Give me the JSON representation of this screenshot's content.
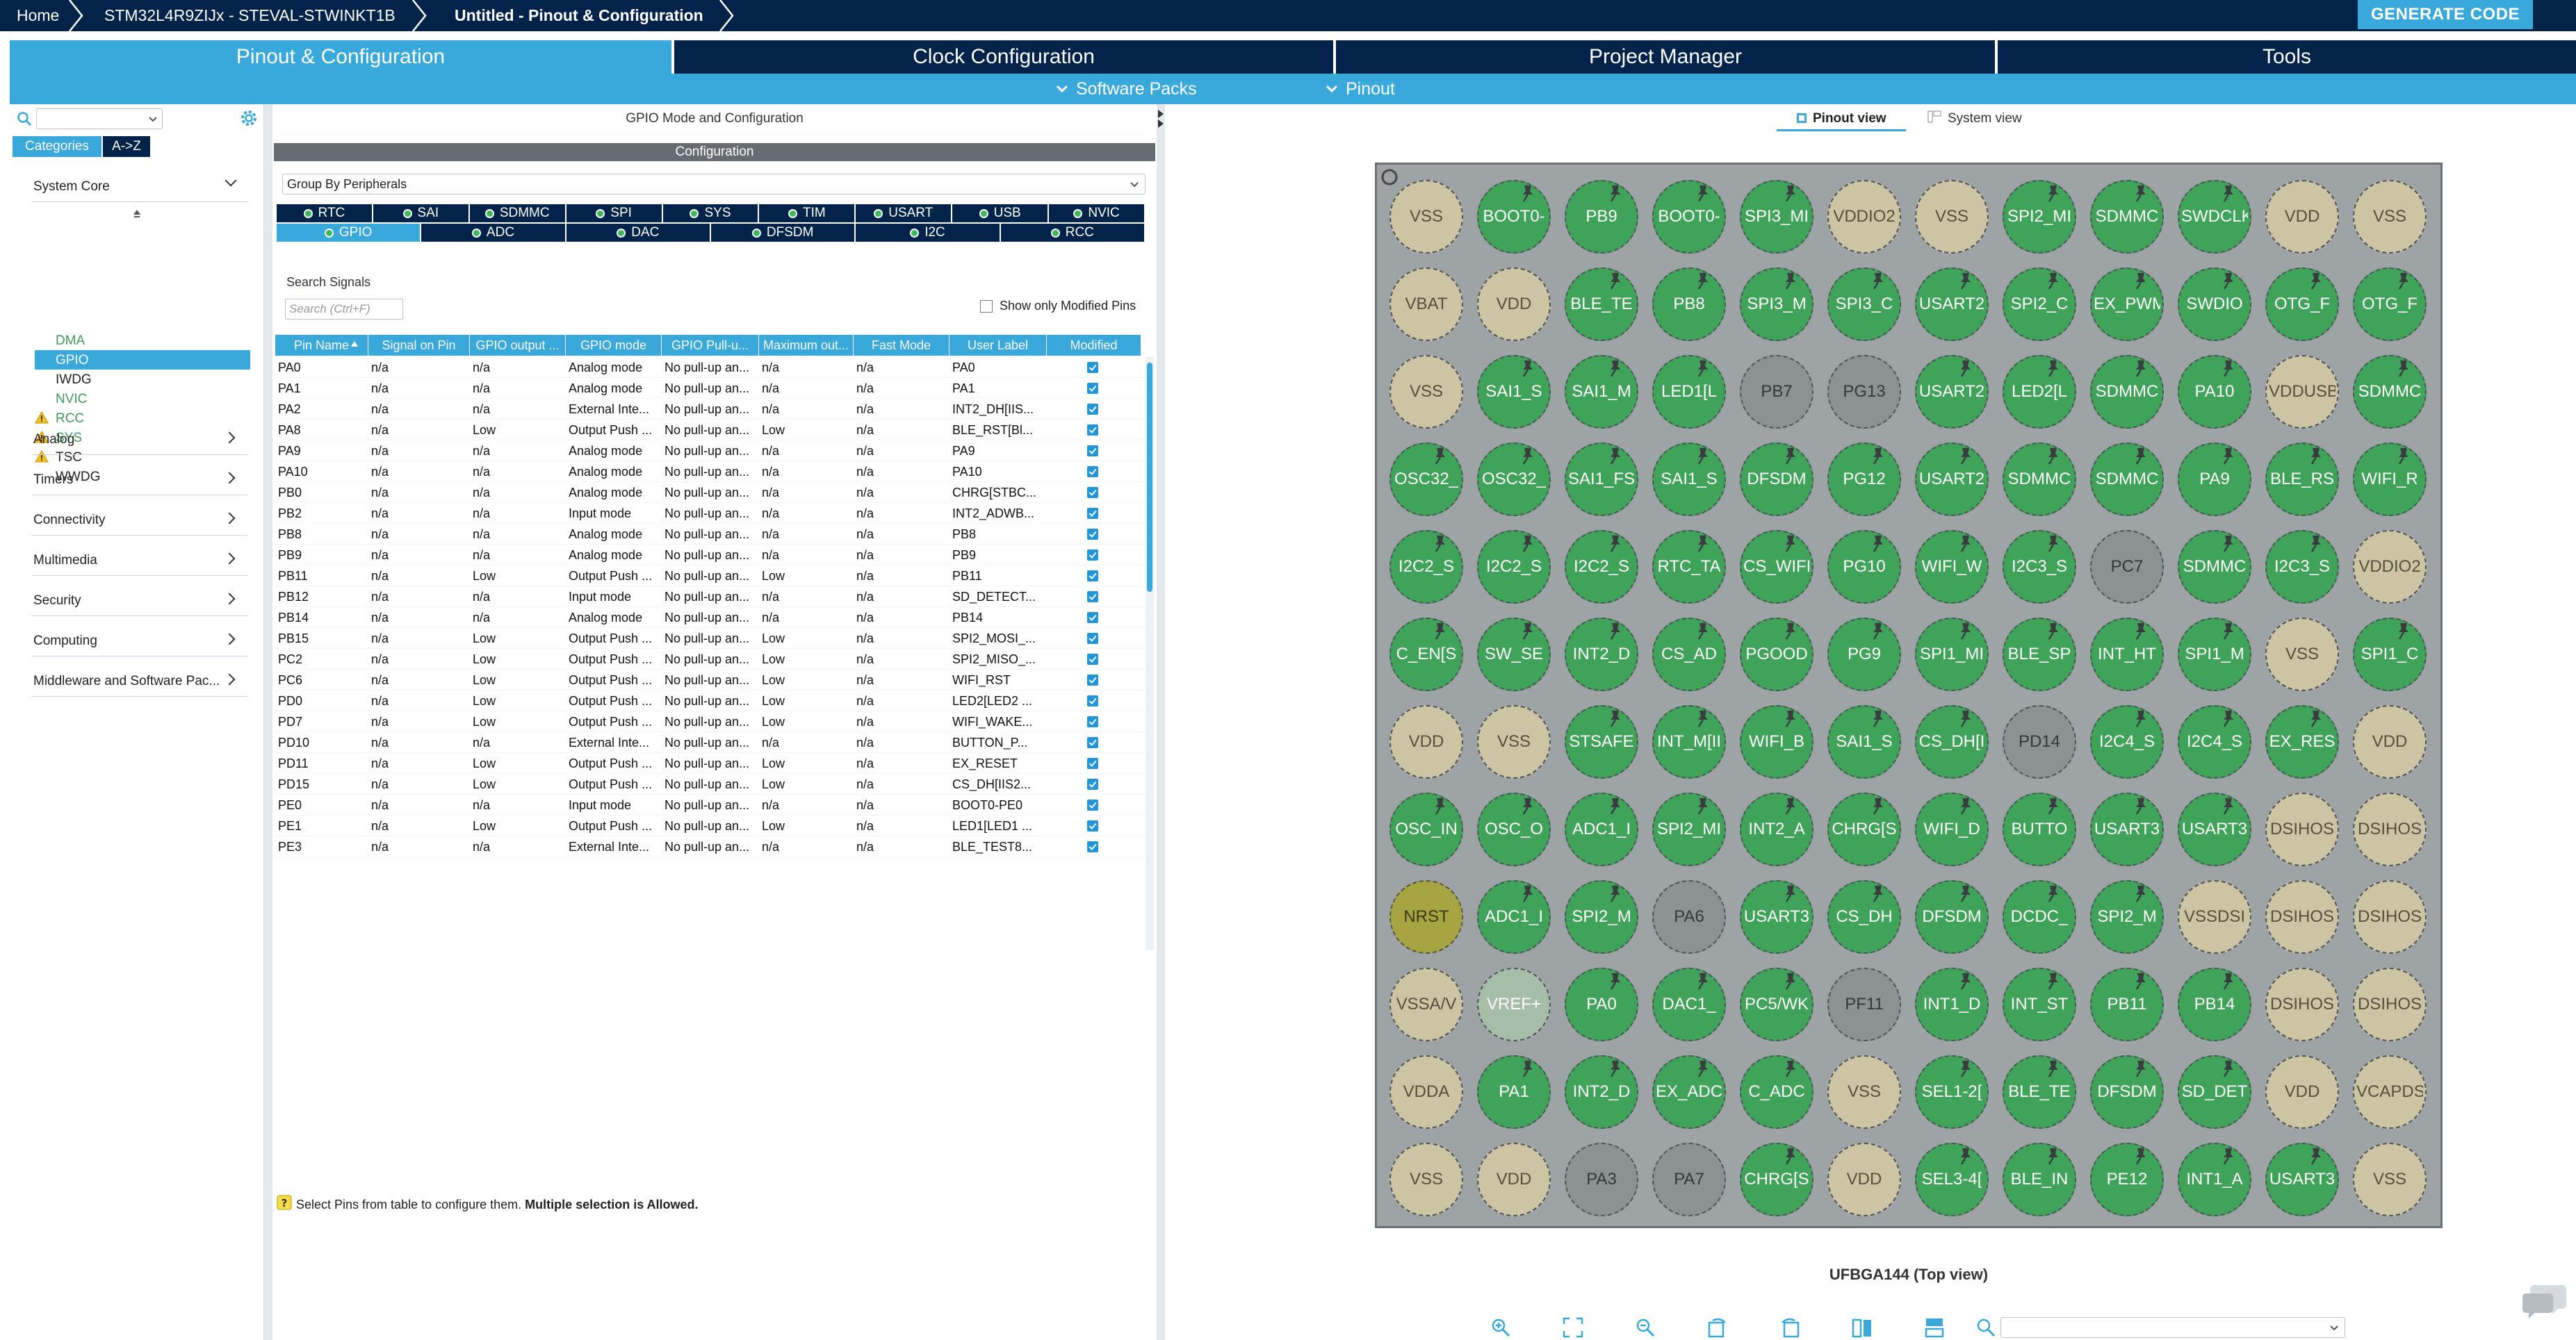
{
  "breadcrumbs": [
    "Home",
    "STM32L4R9ZIJx  -  STEVAL-STWINKT1B",
    "Untitled - Pinout & Configuration"
  ],
  "generate_label": "GENERATE CODE",
  "tabs": [
    "Pinout & Configuration",
    "Clock Configuration",
    "Project Manager",
    "Tools"
  ],
  "subtabs": [
    "Software Packs",
    "Pinout"
  ],
  "left": {
    "cat_tabs": [
      "Categories",
      "A->Z"
    ],
    "sections": [
      "System Core",
      "Analog",
      "Timers",
      "Connectivity",
      "Multimedia",
      "Security",
      "Computing",
      "Middleware and Software Pac..."
    ],
    "system_core_items": [
      {
        "label": "DMA",
        "warn": false,
        "color": "#3f9a5c"
      },
      {
        "label": "GPIO",
        "warn": false,
        "color": "#ffffff",
        "selected": true
      },
      {
        "label": "IWDG",
        "warn": false,
        "color": "#222222"
      },
      {
        "label": "NVIC",
        "warn": false,
        "color": "#3f9a5c"
      },
      {
        "label": "RCC",
        "warn": true,
        "color": "#3f9a5c"
      },
      {
        "label": "SYS",
        "warn": true,
        "color": "#3f9a5c"
      },
      {
        "label": "TSC",
        "warn": true,
        "color": "#222222"
      },
      {
        "label": "WWDG",
        "warn": false,
        "color": "#222222"
      }
    ]
  },
  "center": {
    "title": "GPIO Mode and Configuration",
    "config_label": "Configuration",
    "group_by": "Group By Peripherals",
    "periph_tabs_row1": [
      "RTC",
      "SAI",
      "SDMMC",
      "SPI",
      "SYS",
      "TIM",
      "USART",
      "USB",
      "NVIC"
    ],
    "periph_tabs_row2": [
      "GPIO",
      "ADC",
      "DAC",
      "DFSDM",
      "I2C",
      "RCC"
    ],
    "search_label": "Search Signals",
    "search_placeholder": "Search (Ctrl+F)",
    "show_modified": "Show only Modified Pins",
    "columns": [
      "Pin Name",
      "Signal on Pin",
      "GPIO output ...",
      "GPIO mode",
      "GPIO Pull-u...",
      "Maximum out...",
      "Fast Mode",
      "User Label",
      "Modified"
    ],
    "rows": [
      [
        "PA0",
        "n/a",
        "n/a",
        "Analog mode",
        "No pull-up an...",
        "n/a",
        "n/a",
        "PA0"
      ],
      [
        "PA1",
        "n/a",
        "n/a",
        "Analog mode",
        "No pull-up an...",
        "n/a",
        "n/a",
        "PA1"
      ],
      [
        "PA2",
        "n/a",
        "n/a",
        "External Inte...",
        "No pull-up an...",
        "n/a",
        "n/a",
        "INT2_DH[IIS..."
      ],
      [
        "PA8",
        "n/a",
        "Low",
        "Output Push ...",
        "No pull-up an...",
        "Low",
        "n/a",
        "BLE_RST[Bl..."
      ],
      [
        "PA9",
        "n/a",
        "n/a",
        "Analog mode",
        "No pull-up an...",
        "n/a",
        "n/a",
        "PA9"
      ],
      [
        "PA10",
        "n/a",
        "n/a",
        "Analog mode",
        "No pull-up an...",
        "n/a",
        "n/a",
        "PA10"
      ],
      [
        "PB0",
        "n/a",
        "n/a",
        "Analog mode",
        "No pull-up an...",
        "n/a",
        "n/a",
        "CHRG[STBC..."
      ],
      [
        "PB2",
        "n/a",
        "n/a",
        "Input mode",
        "No pull-up an...",
        "n/a",
        "n/a",
        "INT2_ADWB..."
      ],
      [
        "PB8",
        "n/a",
        "n/a",
        "Analog mode",
        "No pull-up an...",
        "n/a",
        "n/a",
        "PB8"
      ],
      [
        "PB9",
        "n/a",
        "n/a",
        "Analog mode",
        "No pull-up an...",
        "n/a",
        "n/a",
        "PB9"
      ],
      [
        "PB11",
        "n/a",
        "Low",
        "Output Push ...",
        "No pull-up an...",
        "Low",
        "n/a",
        "PB11"
      ],
      [
        "PB12",
        "n/a",
        "n/a",
        "Input mode",
        "No pull-up an...",
        "n/a",
        "n/a",
        "SD_DETECT..."
      ],
      [
        "PB14",
        "n/a",
        "n/a",
        "Analog mode",
        "No pull-up an...",
        "n/a",
        "n/a",
        "PB14"
      ],
      [
        "PB15",
        "n/a",
        "Low",
        "Output Push ...",
        "No pull-up an...",
        "Low",
        "n/a",
        "SPI2_MOSI_..."
      ],
      [
        "PC2",
        "n/a",
        "Low",
        "Output Push ...",
        "No pull-up an...",
        "Low",
        "n/a",
        "SPI2_MISO_..."
      ],
      [
        "PC6",
        "n/a",
        "Low",
        "Output Push ...",
        "No pull-up an...",
        "Low",
        "n/a",
        "WIFI_RST"
      ],
      [
        "PD0",
        "n/a",
        "Low",
        "Output Push ...",
        "No pull-up an...",
        "Low",
        "n/a",
        "LED2[LED2 ..."
      ],
      [
        "PD7",
        "n/a",
        "Low",
        "Output Push ...",
        "No pull-up an...",
        "Low",
        "n/a",
        "WIFI_WAKE..."
      ],
      [
        "PD10",
        "n/a",
        "n/a",
        "External Inte...",
        "No pull-up an...",
        "n/a",
        "n/a",
        "BUTTON_P..."
      ],
      [
        "PD11",
        "n/a",
        "Low",
        "Output Push ...",
        "No pull-up an...",
        "Low",
        "n/a",
        "EX_RESET"
      ],
      [
        "PD15",
        "n/a",
        "Low",
        "Output Push ...",
        "No pull-up an...",
        "Low",
        "n/a",
        "CS_DH[IIS2..."
      ],
      [
        "PE0",
        "n/a",
        "n/a",
        "Input mode",
        "No pull-up an...",
        "n/a",
        "n/a",
        "BOOT0-PE0"
      ],
      [
        "PE1",
        "n/a",
        "Low",
        "Output Push ...",
        "No pull-up an...",
        "Low",
        "n/a",
        "LED1[LED1 ..."
      ],
      [
        "PE3",
        "n/a",
        "n/a",
        "External Inte...",
        "No pull-up an...",
        "n/a",
        "n/a",
        "BLE_TEST8..."
      ]
    ],
    "hint_text": "Select Pins from table to configure them. ",
    "hint_bold": "Multiple selection is Allowed."
  },
  "right": {
    "view_tabs": [
      "Pinout view",
      "System view"
    ],
    "package_label": "UFBGA144 (Top view)",
    "pins": [
      [
        [
          "VSS",
          "y",
          0
        ],
        [
          "BOOT0-",
          "g",
          1
        ],
        [
          "PB9",
          "g",
          1
        ],
        [
          "BOOT0-",
          "g",
          1
        ],
        [
          "SPI3_MI",
          "g",
          1
        ],
        [
          "VDDIO2",
          "y",
          0
        ],
        [
          "VSS",
          "y",
          0
        ],
        [
          "SPI2_MI",
          "g",
          1
        ],
        [
          "SDMMC",
          "g",
          1
        ],
        [
          "SWDCLK",
          "g",
          1
        ],
        [
          "VDD",
          "y",
          0
        ],
        [
          "VSS",
          "y",
          0
        ]
      ],
      [
        [
          "VBAT",
          "y",
          0
        ],
        [
          "VDD",
          "y",
          0
        ],
        [
          "BLE_TE",
          "g",
          1
        ],
        [
          "PB8",
          "g",
          1
        ],
        [
          "SPI3_M",
          "g",
          1
        ],
        [
          "SPI3_C",
          "g",
          1
        ],
        [
          "USART2",
          "g",
          1
        ],
        [
          "SPI2_C",
          "g",
          1
        ],
        [
          "EX_PWM",
          "g",
          1
        ],
        [
          "SWDIO",
          "g",
          1
        ],
        [
          "OTG_F",
          "g",
          1
        ],
        [
          "OTG_F",
          "g",
          1
        ]
      ],
      [
        [
          "VSS",
          "y",
          0
        ],
        [
          "SAI1_S",
          "g",
          1
        ],
        [
          "SAI1_M",
          "g",
          1
        ],
        [
          "LED1[L",
          "g",
          1
        ],
        [
          "PB7",
          "r",
          0
        ],
        [
          "PG13",
          "r",
          0
        ],
        [
          "USART2",
          "g",
          1
        ],
        [
          "LED2[L",
          "g",
          1
        ],
        [
          "SDMMC",
          "g",
          1
        ],
        [
          "PA10",
          "g",
          1
        ],
        [
          "VDDUSB",
          "y",
          0
        ],
        [
          "SDMMC",
          "g",
          1
        ]
      ],
      [
        [
          "OSC32_",
          "g",
          1
        ],
        [
          "OSC32_",
          "g",
          1
        ],
        [
          "SAI1_FS",
          "g",
          1
        ],
        [
          "SAI1_S",
          "g",
          1
        ],
        [
          "DFSDM",
          "g",
          1
        ],
        [
          "PG12",
          "g",
          1
        ],
        [
          "USART2",
          "g",
          1
        ],
        [
          "SDMMC",
          "g",
          1
        ],
        [
          "SDMMC",
          "g",
          1
        ],
        [
          "PA9",
          "g",
          1
        ],
        [
          "BLE_RS",
          "g",
          1
        ],
        [
          "WIFI_R",
          "g",
          1
        ]
      ],
      [
        [
          "I2C2_S",
          "g",
          1
        ],
        [
          "I2C2_S",
          "g",
          1
        ],
        [
          "I2C2_S",
          "g",
          1
        ],
        [
          "RTC_TA",
          "g",
          1
        ],
        [
          "CS_WIFI",
          "g",
          1
        ],
        [
          "PG10",
          "g",
          1
        ],
        [
          "WIFI_W",
          "g",
          1
        ],
        [
          "I2C3_S",
          "g",
          1
        ],
        [
          "PC7",
          "r",
          0
        ],
        [
          "SDMMC",
          "g",
          1
        ],
        [
          "I2C3_S",
          "g",
          1
        ],
        [
          "VDDIO2",
          "y",
          0
        ]
      ],
      [
        [
          "C_EN[S",
          "g",
          1
        ],
        [
          "SW_SE",
          "g",
          1
        ],
        [
          "INT2_D",
          "g",
          1
        ],
        [
          "CS_AD",
          "g",
          1
        ],
        [
          "PGOOD",
          "g",
          1
        ],
        [
          "PG9",
          "g",
          1
        ],
        [
          "SPI1_MI",
          "g",
          1
        ],
        [
          "BLE_SP",
          "g",
          1
        ],
        [
          "INT_HT",
          "g",
          1
        ],
        [
          "SPI1_M",
          "g",
          1
        ],
        [
          "VSS",
          "y",
          0
        ],
        [
          "SPI1_C",
          "g",
          1
        ]
      ],
      [
        [
          "VDD",
          "y",
          0
        ],
        [
          "VSS",
          "y",
          0
        ],
        [
          "STSAFE",
          "g",
          1
        ],
        [
          "INT_M[II",
          "g",
          1
        ],
        [
          "WIFI_B",
          "g",
          1
        ],
        [
          "SAI1_S",
          "g",
          1
        ],
        [
          "CS_DH[I",
          "g",
          1
        ],
        [
          "PD14",
          "r",
          0
        ],
        [
          "I2C4_S",
          "g",
          1
        ],
        [
          "I2C4_S",
          "g",
          1
        ],
        [
          "EX_RES",
          "g",
          1
        ],
        [
          "VDD",
          "y",
          0
        ]
      ],
      [
        [
          "OSC_IN",
          "g",
          1
        ],
        [
          "OSC_O",
          "g",
          1
        ],
        [
          "ADC1_I",
          "g",
          1
        ],
        [
          "SPI2_MI",
          "g",
          1
        ],
        [
          "INT2_A",
          "g",
          1
        ],
        [
          "CHRG[S",
          "g",
          1
        ],
        [
          "WIFI_D",
          "g",
          1
        ],
        [
          "BUTTO",
          "g",
          1
        ],
        [
          "USART3",
          "g",
          1
        ],
        [
          "USART3",
          "g",
          1
        ],
        [
          "DSIHOS",
          "y",
          0
        ],
        [
          "DSIHOS",
          "y",
          0
        ]
      ],
      [
        [
          "NRST",
          "k",
          0
        ],
        [
          "ADC1_I",
          "g",
          1
        ],
        [
          "SPI2_M",
          "g",
          1
        ],
        [
          "PA6",
          "r",
          0
        ],
        [
          "USART3",
          "g",
          1
        ],
        [
          "CS_DH",
          "g",
          1
        ],
        [
          "DFSDM",
          "g",
          1
        ],
        [
          "DCDC_",
          "g",
          1
        ],
        [
          "SPI2_M",
          "g",
          1
        ],
        [
          "VSSDSI",
          "y",
          0
        ],
        [
          "DSIHOS",
          "y",
          0
        ],
        [
          "DSIHOS",
          "y",
          0
        ]
      ],
      [
        [
          "VSSA/V",
          "y",
          0
        ],
        [
          "VREF+",
          "s",
          0
        ],
        [
          "PA0",
          "g",
          1
        ],
        [
          "DAC1_",
          "g",
          1
        ],
        [
          "PC5/WK",
          "g",
          1
        ],
        [
          "PF11",
          "r",
          0
        ],
        [
          "INT1_D",
          "g",
          1
        ],
        [
          "INT_ST",
          "g",
          1
        ],
        [
          "PB11",
          "g",
          1
        ],
        [
          "PB14",
          "g",
          1
        ],
        [
          "DSIHOS",
          "y",
          0
        ],
        [
          "DSIHOS",
          "y",
          0
        ]
      ],
      [
        [
          "VDDA",
          "y",
          0
        ],
        [
          "PA1",
          "g",
          1
        ],
        [
          "INT2_D",
          "g",
          1
        ],
        [
          "EX_ADC",
          "g",
          1
        ],
        [
          "C_ADC",
          "g",
          1
        ],
        [
          "VSS",
          "y",
          0
        ],
        [
          "SEL1-2[",
          "g",
          1
        ],
        [
          "BLE_TE",
          "g",
          1
        ],
        [
          "DFSDM",
          "g",
          1
        ],
        [
          "SD_DET",
          "g",
          1
        ],
        [
          "VDD",
          "y",
          0
        ],
        [
          "VCAPDSI",
          "y",
          0
        ]
      ],
      [
        [
          "VSS",
          "y",
          0
        ],
        [
          "VDD",
          "y",
          0
        ],
        [
          "PA3",
          "r",
          0
        ],
        [
          "PA7",
          "r",
          0
        ],
        [
          "CHRG[S",
          "g",
          1
        ],
        [
          "VDD",
          "y",
          0
        ],
        [
          "SEL3-4[",
          "g",
          1
        ],
        [
          "BLE_IN",
          "g",
          1
        ],
        [
          "PE12",
          "g",
          1
        ],
        [
          "INT1_A",
          "g",
          1
        ],
        [
          "USART3",
          "g",
          1
        ],
        [
          "VSS",
          "y",
          0
        ]
      ]
    ]
  }
}
